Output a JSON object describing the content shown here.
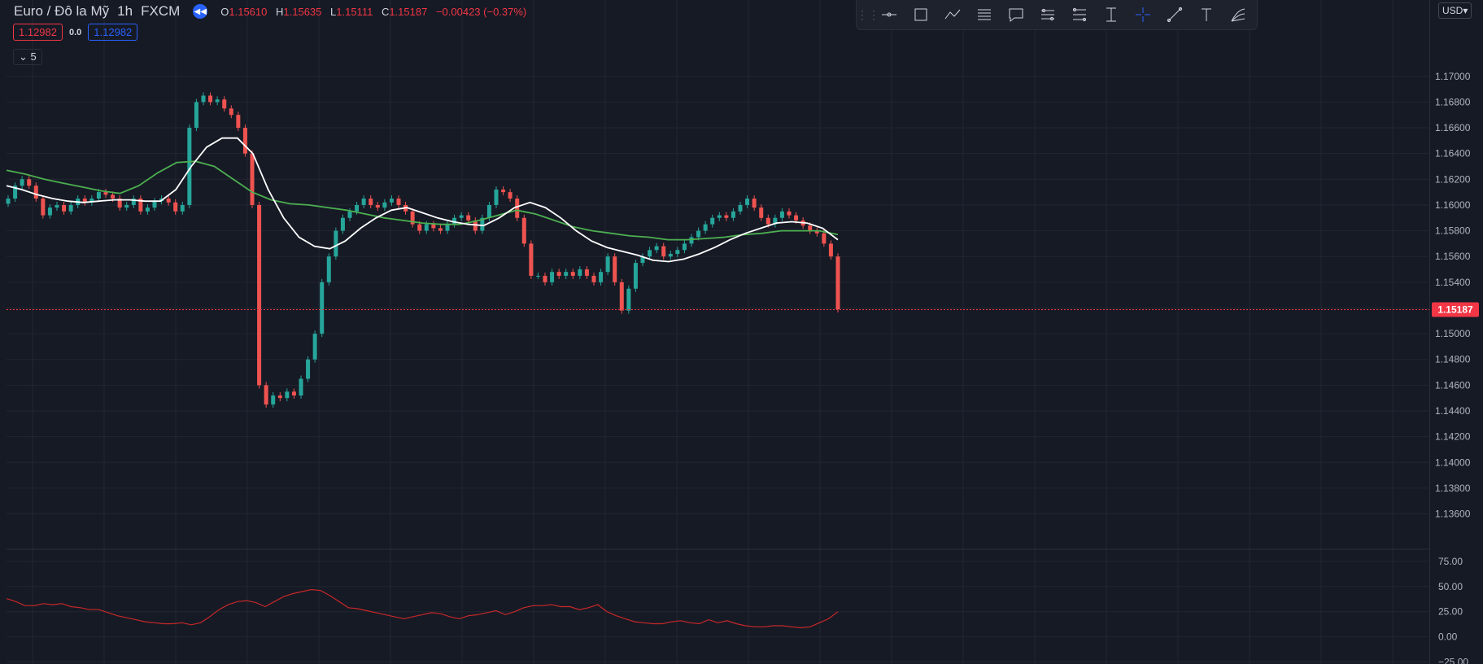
{
  "header": {
    "symbol": "Euro / Đô la Mỹ",
    "interval": "1h",
    "exchange": "FXCM",
    "o_label": "O",
    "o": "1.15610",
    "h_label": "H",
    "h": "1.15635",
    "l_label": "L",
    "l": "1.15111",
    "c_label": "C",
    "c": "1.15187",
    "change": "−0.00423 (−0.37%)",
    "bid": "1.12982",
    "spread": "0.0",
    "ask": "1.12982",
    "indicators_count": "5",
    "currency": "USD"
  },
  "toolbar": {
    "tools": [
      "horizontal-ray-icon",
      "rectangle-icon",
      "path-icon",
      "horizontal-lines-icon",
      "callout-icon",
      "parallel-channel-icon",
      "fib-channel-icon",
      "price-range-icon",
      "crosshair-icon",
      "trend-line-icon",
      "text-icon",
      "fib-fan-icon"
    ]
  },
  "colors": {
    "background": "#161a25",
    "grid": "#232632",
    "up": "#26a69a",
    "down": "#ef5350",
    "ma_fast": "#ffffff",
    "ma_slow": "#4caf50",
    "osc": "#c62828",
    "last_price": "#f23645"
  },
  "chart_data": [
    {
      "type": "candlestick",
      "y_ticks": [
        "1.17000",
        "1.16800",
        "1.16600",
        "1.16400",
        "1.16200",
        "1.16000",
        "1.15800",
        "1.15600",
        "1.15400",
        "1.15200",
        "1.15000",
        "1.14800",
        "1.14600",
        "1.14400",
        "1.14200",
        "1.14000",
        "1.13800",
        "1.13600"
      ],
      "ylim": [
        1.1342,
        1.1734
      ],
      "last_price": 1.15187,
      "last_price_label": "1.15187",
      "series": {
        "candles_close": [
          1.1605,
          1.1615,
          1.162,
          1.1615,
          1.1605,
          1.1592,
          1.1598,
          1.16,
          1.1595,
          1.16,
          1.1605,
          1.1602,
          1.1605,
          1.161,
          1.1608,
          1.1605,
          1.1598,
          1.16,
          1.1605,
          1.1595,
          1.1598,
          1.1603,
          1.1605,
          1.1602,
          1.1595,
          1.16,
          1.166,
          1.168,
          1.1685,
          1.168,
          1.1682,
          1.1675,
          1.167,
          1.166,
          1.164,
          1.16,
          1.146,
          1.1445,
          1.1452,
          1.145,
          1.1455,
          1.1452,
          1.1465,
          1.148,
          1.15,
          1.154,
          1.156,
          1.158,
          1.159,
          1.1595,
          1.16,
          1.1605,
          1.16,
          1.1598,
          1.1602,
          1.1605,
          1.16,
          1.1595,
          1.1585,
          1.158,
          1.1585,
          1.1582,
          1.158,
          1.1585,
          1.159,
          1.1592,
          1.1588,
          1.158,
          1.159,
          1.16,
          1.1612,
          1.161,
          1.1605,
          1.159,
          1.157,
          1.1545,
          1.1545,
          1.154,
          1.1548,
          1.1545,
          1.1548,
          1.1545,
          1.155,
          1.1545,
          1.154,
          1.1548,
          1.156,
          1.154,
          1.1518,
          1.1535,
          1.1555,
          1.156,
          1.1565,
          1.1568,
          1.156,
          1.1562,
          1.1565,
          1.157,
          1.1575,
          1.158,
          1.1585,
          1.159,
          1.1592,
          1.159,
          1.1595,
          1.16,
          1.1605,
          1.1598,
          1.159,
          1.1585,
          1.159,
          1.1595,
          1.1592,
          1.1588,
          1.1584,
          1.158,
          1.1578,
          1.157,
          1.156,
          1.1519
        ],
        "ma_fast": [
          1.1615,
          1.1612,
          1.1608,
          1.1605,
          1.1603,
          1.1602,
          1.1603,
          1.1604,
          1.1604,
          1.1603,
          1.1603,
          1.1612,
          1.163,
          1.1645,
          1.1652,
          1.1652,
          1.164,
          1.1612,
          1.159,
          1.1575,
          1.1568,
          1.1566,
          1.1572,
          1.1582,
          1.159,
          1.1596,
          1.1598,
          1.1594,
          1.159,
          1.1587,
          1.1585,
          1.1584,
          1.159,
          1.1598,
          1.1602,
          1.1598,
          1.159,
          1.158,
          1.1572,
          1.1567,
          1.1564,
          1.1561,
          1.1557,
          1.1556,
          1.1558,
          1.1562,
          1.1567,
          1.1573,
          1.1578,
          1.1582,
          1.1586,
          1.1587,
          1.1586,
          1.1582,
          1.1573
        ],
        "ma_slow": [
          1.1627,
          1.1624,
          1.162,
          1.1617,
          1.1614,
          1.1611,
          1.1609,
          1.1615,
          1.1625,
          1.1633,
          1.1634,
          1.163,
          1.162,
          1.161,
          1.1604,
          1.1601,
          1.16,
          1.1598,
          1.1596,
          1.1593,
          1.159,
          1.1588,
          1.1586,
          1.1585,
          1.1585,
          1.1588,
          1.1592,
          1.1596,
          1.1593,
          1.1588,
          1.1583,
          1.158,
          1.1578,
          1.1576,
          1.1575,
          1.1573,
          1.1573,
          1.1574,
          1.1575,
          1.1577,
          1.1578,
          1.158,
          1.158,
          1.158,
          1.1577
        ]
      }
    },
    {
      "type": "line",
      "y_ticks": [
        "75.00",
        "50.00",
        "25.00",
        "0.00",
        "−25.00"
      ],
      "ylim": [
        -27,
        83
      ],
      "series": [
        {
          "values": [
            38,
            35,
            31,
            31,
            33,
            32,
            33,
            30,
            29,
            27,
            27,
            24,
            21,
            19,
            17,
            15,
            14,
            13,
            13,
            14,
            12,
            14,
            20,
            27,
            32,
            35,
            36,
            34,
            30,
            35,
            40,
            43,
            45,
            47,
            46,
            41,
            35,
            29,
            28,
            26,
            24,
            22,
            20,
            18,
            20,
            22,
            24,
            23,
            20,
            18,
            21,
            22,
            24,
            26,
            22,
            25,
            29,
            31,
            31,
            32,
            30,
            30,
            27,
            29,
            32,
            25,
            21,
            18,
            15,
            14,
            13,
            13,
            15,
            16,
            14,
            13,
            17,
            14,
            16,
            13,
            11,
            10,
            10,
            11,
            11,
            10,
            9,
            10,
            14,
            18,
            25
          ]
        }
      ]
    }
  ]
}
